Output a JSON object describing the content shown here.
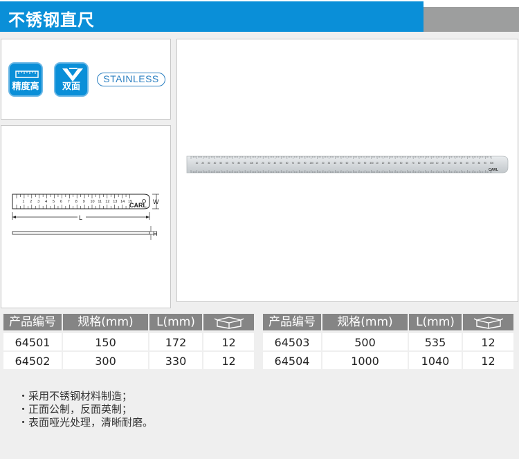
{
  "header": {
    "title": "不锈钢直尺"
  },
  "badges": {
    "precision": {
      "label": "精度高"
    },
    "double_sided": {
      "label": "双面"
    },
    "stainless": {
      "label": "STAINLESS"
    }
  },
  "drawing": {
    "scale_numbers": [
      "1",
      "2",
      "3",
      "4",
      "5",
      "6",
      "7",
      "8",
      "9",
      "10",
      "11",
      "12",
      "13",
      "14",
      "15"
    ],
    "brand": "CARL",
    "dim_w": "W",
    "dim_l": "L",
    "dim_h": "H"
  },
  "photo": {
    "scale_numbers": [
      "10",
      "20",
      "30",
      "40",
      "50",
      "60",
      "70",
      "80",
      "90",
      "100",
      "10",
      "20",
      "30",
      "40",
      "50",
      "60",
      "70",
      "80",
      "90",
      "200",
      "10",
      "20",
      "30",
      "40",
      "50",
      "60",
      "70",
      "80",
      "90",
      "300",
      "10",
      "20",
      "30",
      "40",
      "50",
      "60",
      "70",
      "80",
      "90",
      "400",
      "10",
      "20",
      "30",
      "40",
      "50",
      "60",
      "70",
      "80",
      "90",
      "500"
    ],
    "brand": "CARL"
  },
  "table": {
    "headers": [
      "产品编号",
      "规格(mm)",
      "L(mm)",
      "",
      "产品编号",
      "规格(mm)",
      "L(mm)",
      ""
    ],
    "box_icon": "package-box-icon",
    "rows": [
      [
        "64501",
        "150",
        "172",
        "12",
        "64503",
        "500",
        "535",
        "12"
      ],
      [
        "64502",
        "300",
        "330",
        "12",
        "64504",
        "1000",
        "1040",
        "12"
      ]
    ]
  },
  "notes": [
    "・采用不锈钢材料制造；",
    "・正面公制，反面英制；",
    "・表面哑光处理，清晰耐磨。"
  ],
  "colors": {
    "accent": "#0a8fd8",
    "header_gray": "#9d9e9e",
    "table_head": "#858585"
  }
}
